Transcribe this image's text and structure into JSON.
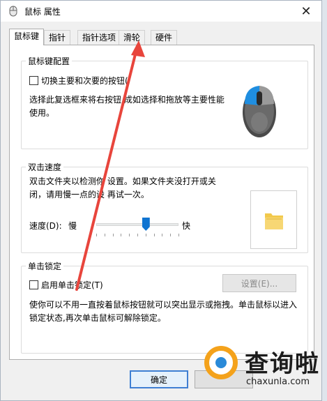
{
  "window": {
    "title": "鼠标 属性",
    "close_glyph": "✕"
  },
  "tabs": [
    {
      "label": "鼠标键",
      "active": true
    },
    {
      "label": "指针",
      "active": false
    },
    {
      "label": "指针选项",
      "active": false
    },
    {
      "label": "滑轮",
      "active": false
    },
    {
      "label": "硬件",
      "active": false
    }
  ],
  "button_config": {
    "legend": "鼠标键配置",
    "switch_label": "切换主要和次要的按钮(",
    "switch_checked": false,
    "description": "选择此复选框来将右按钮 成如选择和拖放等主要性能使用。"
  },
  "double_click": {
    "legend": "双击速度",
    "description": "双击文件夹以检测你 设置。如果文件夹没打开或关闭，请用慢一点的设 再试一次。",
    "speed_label": "速度(D):",
    "slow": "慢",
    "fast": "快",
    "speed_fraction": 0.6
  },
  "click_lock": {
    "legend": "单击锁定",
    "enable_label": "启用单击锁定(T)",
    "enable_checked": false,
    "settings_button": "设置(E)...",
    "description": "使你可以不用一直按着鼠标按钮就可以突出显示或拖拽。单击鼠标以进入锁定状态,再次单击鼠标可解除锁定。"
  },
  "footer": {
    "ok": "确定"
  },
  "watermark": {
    "title": "查询啦",
    "domain": "chaxunla.com"
  },
  "colors": {
    "accent": "#0f74d1",
    "arrow": "#e8453c",
    "watermark_orange": "#f4a21b",
    "watermark_blue": "#2a8ad8"
  },
  "icons": [
    "mouse-icon",
    "folder-icon",
    "close-icon"
  ]
}
